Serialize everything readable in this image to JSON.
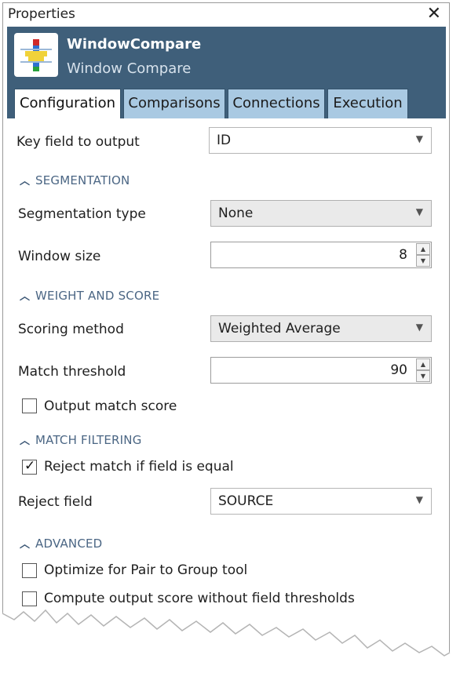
{
  "window": {
    "title": "Properties",
    "close_glyph": "✕"
  },
  "tool": {
    "name": "WindowCompare",
    "subtitle": "Window Compare",
    "icon": "window-compare-icon"
  },
  "tabs": [
    {
      "label": "Configuration",
      "active": true
    },
    {
      "label": "Comparisons",
      "active": false
    },
    {
      "label": "Connections",
      "active": false
    },
    {
      "label": "Execution",
      "active": false
    }
  ],
  "config": {
    "key_field": {
      "label": "Key field to output",
      "value": "ID"
    },
    "segmentation": {
      "header": "SEGMENTATION",
      "type_label": "Segmentation type",
      "type_value": "None",
      "window_label": "Window size",
      "window_value": "8"
    },
    "weight": {
      "header": "WEIGHT AND SCORE",
      "method_label": "Scoring method",
      "method_value": "Weighted Average",
      "threshold_label": "Match threshold",
      "threshold_value": "90",
      "output_score_label": "Output match score",
      "output_score_checked": false
    },
    "filtering": {
      "header": "MATCH FILTERING",
      "reject_equal_label": "Reject match if field is equal",
      "reject_equal_checked": true,
      "reject_field_label": "Reject field",
      "reject_field_value": "SOURCE"
    },
    "advanced": {
      "header": "ADVANCED",
      "optimize_label": "Optimize for Pair to Group tool",
      "optimize_checked": false,
      "compute_label": "Compute output score without field thresholds",
      "compute_checked": false
    }
  },
  "colors": {
    "header_bg": "#3f5f7a",
    "tab_bg": "#a9c9e2",
    "section_text": "#4b6684"
  }
}
